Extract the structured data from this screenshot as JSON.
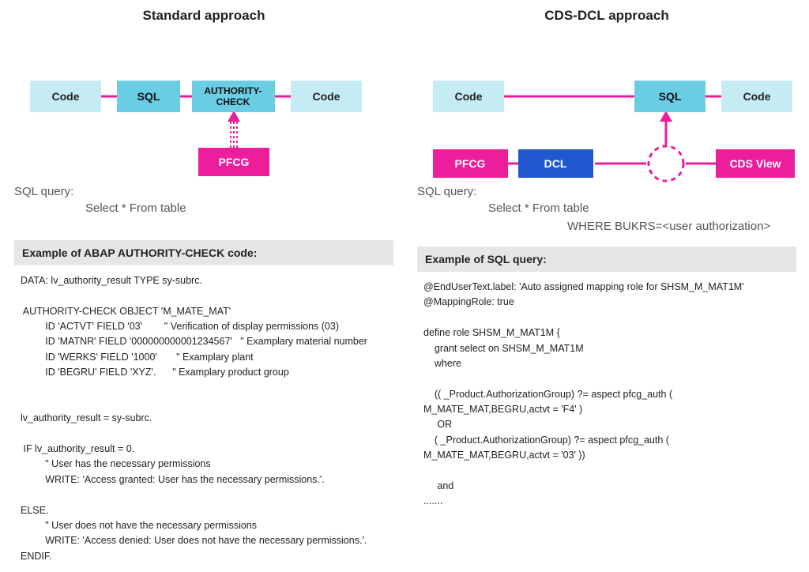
{
  "left": {
    "title": "Standard approach",
    "boxes": {
      "code1": "Code",
      "sql": "SQL",
      "auth": "AUTHORITY-\nCHECK",
      "code2": "Code",
      "pfcg": "PFCG"
    },
    "sqlLabel": "SQL query:",
    "sqlLine1": "Select  * From table",
    "exampleHead": "Example of ABAP AUTHORITY-CHECK code:",
    "code": "DATA: lv_authority_result TYPE sy-subrc.\n\n AUTHORITY-CHECK OBJECT 'M_MATE_MAT'\n         ID 'ACTVT' FIELD '03'        \" Verification of display permissions (03)\n         ID 'MATNR' FIELD '000000000001234567'   \" Examplary material number\n         ID 'WERKS' FIELD '1000'       \" Examplary plant\n         ID 'BEGRU' FIELD 'XYZ'.      \" Examplary product group\n\n\nlv_authority_result = sy-subrc.\n\n IF lv_authority_result = 0.\n         \" User has the necessary permissions\n         WRITE: 'Access granted: User has the necessary permissions.'.\n\nELSE.\n         \" User does not have the necessary permissions\n         WRITE: 'Access denied: User does not have the necessary permissions.'.\nENDIF."
  },
  "right": {
    "title": "CDS-DCL approach",
    "boxes": {
      "code1": "Code",
      "sql": "SQL",
      "code2": "Code",
      "pfcg": "PFCG",
      "dcl": "DCL",
      "cds": "CDS View"
    },
    "sqlLabel": "SQL query:",
    "sqlLine1": "Select  * From table",
    "sqlLine2": "WHERE BUKRS=<user authorization>",
    "exampleHead": "Example of SQL query:",
    "code": "@EndUserText.label: 'Auto assigned mapping role for SHSM_M_MAT1M'\n@MappingRole: true\n\ndefine role SHSM_M_MAT1M {\n    grant select on SHSM_M_MAT1M\n    where\n\n    (( _Product.AuthorizationGroup) ?= aspect pfcg_auth (\nM_MATE_MAT,BEGRU,actvt = 'F4' )\n     OR\n    ( _Product.AuthorizationGroup) ?= aspect pfcg_auth (\nM_MATE_MAT,BEGRU,actvt = '03' ))\n\n     and\n......."
  },
  "colors": {
    "lightCyan": "#c5ecf4",
    "midCyan": "#69cde4",
    "magenta": "#ec1e9b",
    "blue": "#2058d0",
    "boxStroke": "#7fb9c9"
  }
}
